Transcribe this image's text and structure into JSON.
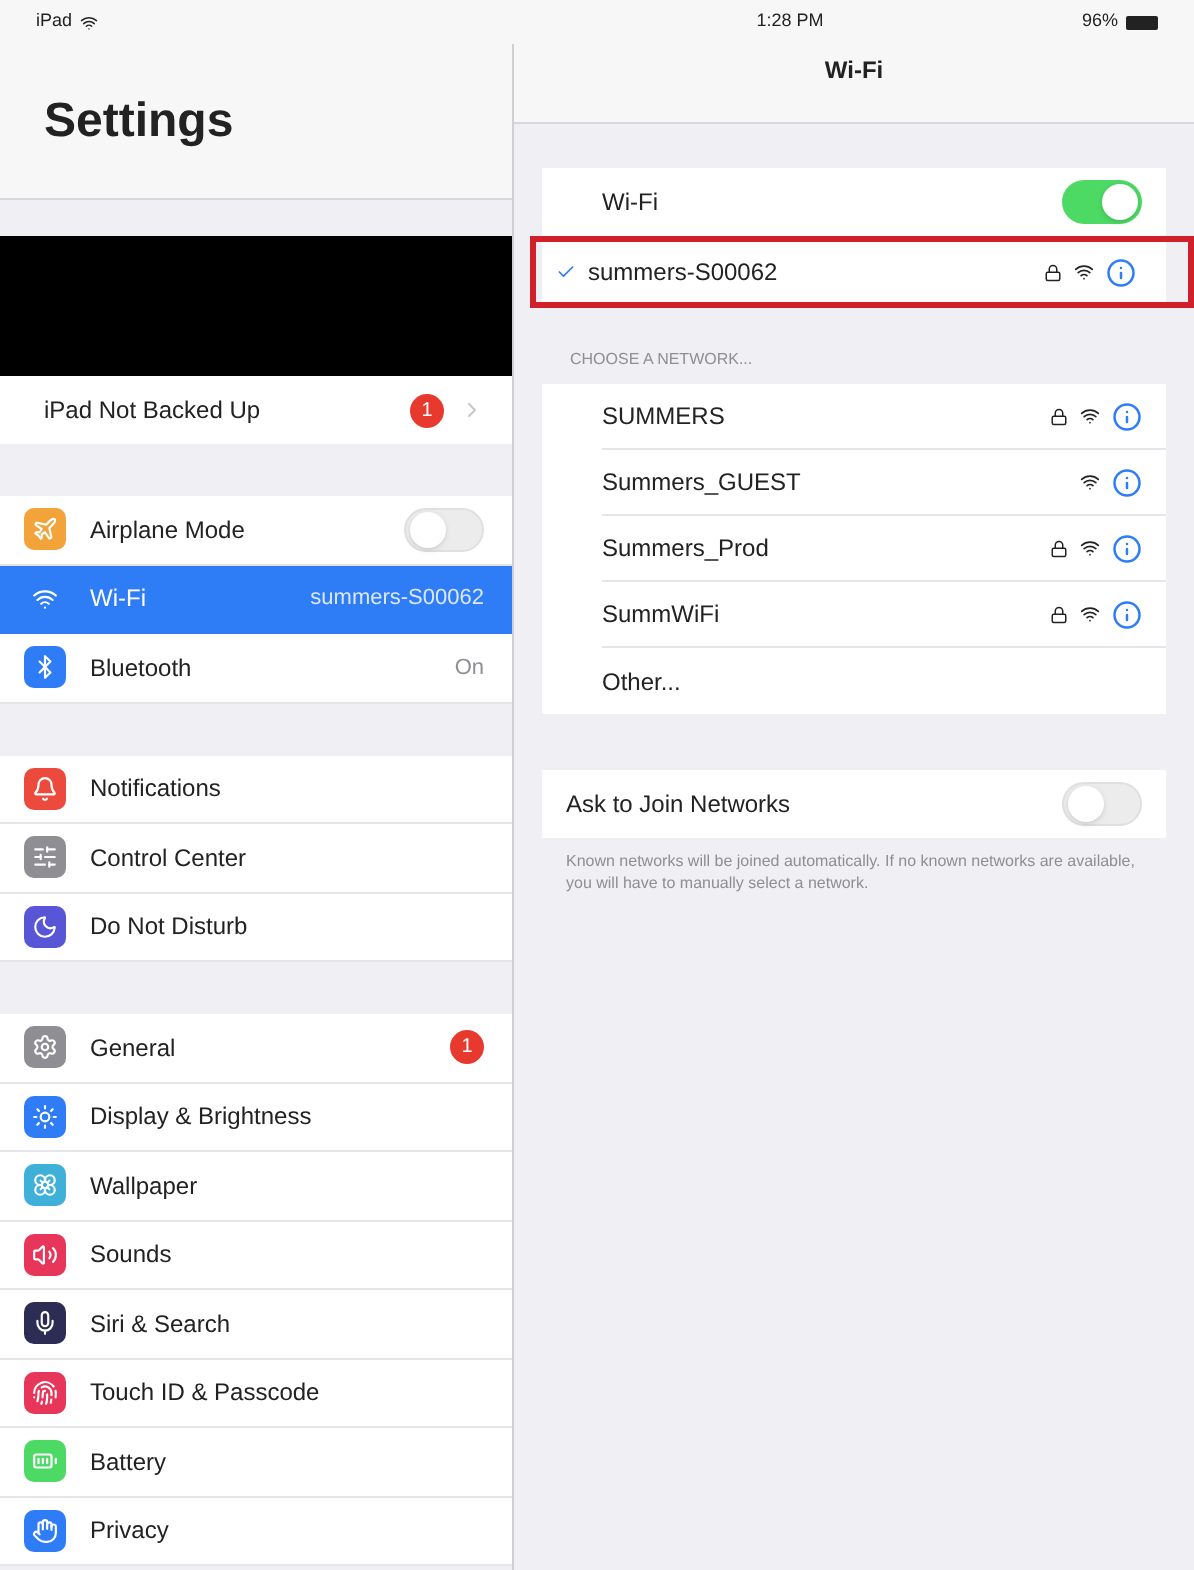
{
  "status_bar": {
    "carrier": "iPad",
    "time": "1:28 PM",
    "battery": "96%"
  },
  "sidebar": {
    "title": "Settings",
    "account_row": {
      "label": "iPad Not Backed Up",
      "badge": "1"
    },
    "groups": [
      {
        "items": [
          {
            "label": "Airplane Mode",
            "kind": "toggle",
            "on": false,
            "selected": false,
            "color": "#f2a33a"
          },
          {
            "label": "Wi-Fi",
            "kind": "value",
            "value": "summers-S00062",
            "selected": true,
            "color": "#2f7df6"
          },
          {
            "label": "Bluetooth",
            "kind": "value",
            "value": "On",
            "selected": false,
            "color": "#2f7df6"
          }
        ]
      },
      {
        "items": [
          {
            "label": "Notifications",
            "kind": "plain",
            "selected": false,
            "color": "#ec4a3c"
          },
          {
            "label": "Control Center",
            "kind": "plain",
            "selected": false,
            "color": "#8e8e93"
          },
          {
            "label": "Do Not Disturb",
            "kind": "plain",
            "selected": false,
            "color": "#5856d6"
          }
        ]
      },
      {
        "items": [
          {
            "label": "General",
            "kind": "badge",
            "badge": "1",
            "selected": false,
            "color": "#8e8e93"
          },
          {
            "label": "Display & Brightness",
            "kind": "plain",
            "selected": false,
            "color": "#2f7df6"
          },
          {
            "label": "Wallpaper",
            "kind": "plain",
            "selected": false,
            "color": "#3fb1d8"
          },
          {
            "label": "Sounds",
            "kind": "plain",
            "selected": false,
            "color": "#e8365a"
          },
          {
            "label": "Siri & Search",
            "kind": "plain",
            "selected": false,
            "color": "#2c2c54"
          },
          {
            "label": "Touch ID & Passcode",
            "kind": "plain",
            "selected": false,
            "color": "#e8365a"
          },
          {
            "label": "Battery",
            "kind": "plain",
            "selected": false,
            "color": "#4cd964"
          },
          {
            "label": "Privacy",
            "kind": "plain",
            "selected": false,
            "color": "#2f7df6"
          }
        ]
      }
    ]
  },
  "detail": {
    "title": "Wi-Fi",
    "wifi_toggle": {
      "label": "Wi-Fi",
      "on": true
    },
    "connected": {
      "name": "summers-S00062",
      "locked": true,
      "highlighted": true
    },
    "section_header": "CHOOSE A NETWORK...",
    "networks": [
      {
        "name": "SUMMERS",
        "locked": true
      },
      {
        "name": "Summers_GUEST",
        "locked": false
      },
      {
        "name": "Summers_Prod",
        "locked": true
      },
      {
        "name": "SummWiFi",
        "locked": true
      }
    ],
    "other": "Other...",
    "ask_to_join": {
      "label": "Ask to Join Networks",
      "on": false
    },
    "footnote": "Known networks will be joined automatically. If no known networks are available, you will have to manually select a network."
  }
}
